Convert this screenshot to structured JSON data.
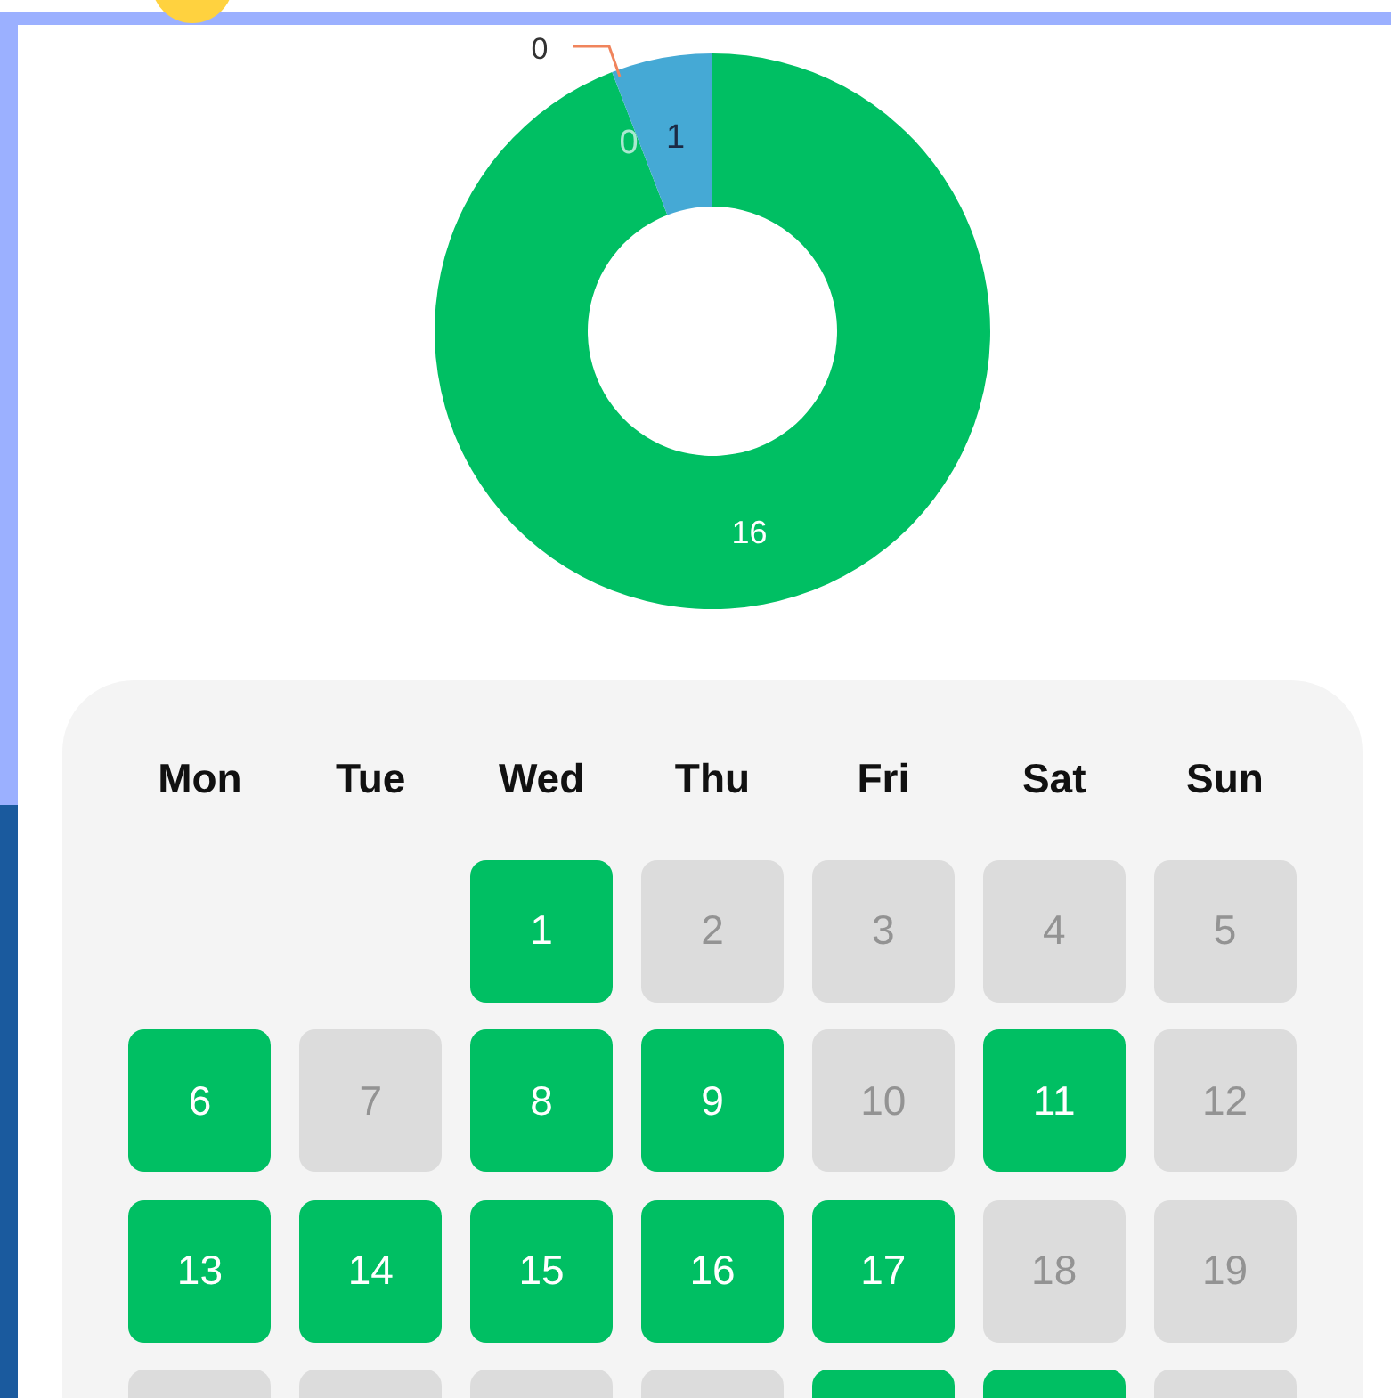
{
  "chart_data": {
    "type": "donut",
    "data_labels": true,
    "value_labels": [
      "16",
      "1",
      "0",
      "0"
    ],
    "series": [
      {
        "values": [
          16,
          1,
          0,
          0
        ],
        "colors": [
          "#00bf63",
          "#45a9d5",
          "#a9e8d0",
          "#f0845c"
        ]
      }
    ]
  },
  "calendar": {
    "weekdays": [
      "Mon",
      "Tue",
      "Wed",
      "Thu",
      "Fri",
      "Sat",
      "Sun"
    ],
    "weeks": [
      [
        {
          "kind": "blank"
        },
        {
          "kind": "blank"
        },
        {
          "kind": "day",
          "day": "1",
          "done": true
        },
        {
          "kind": "day",
          "day": "2",
          "done": false
        },
        {
          "kind": "day",
          "day": "3",
          "done": false
        },
        {
          "kind": "day",
          "day": "4",
          "done": false
        },
        {
          "kind": "day",
          "day": "5",
          "done": false
        }
      ],
      [
        {
          "kind": "day",
          "day": "6",
          "done": true
        },
        {
          "kind": "day",
          "day": "7",
          "done": false
        },
        {
          "kind": "day",
          "day": "8",
          "done": true
        },
        {
          "kind": "day",
          "day": "9",
          "done": true
        },
        {
          "kind": "day",
          "day": "10",
          "done": false
        },
        {
          "kind": "day",
          "day": "11",
          "done": true
        },
        {
          "kind": "day",
          "day": "12",
          "done": false
        }
      ],
      [
        {
          "kind": "day",
          "day": "13",
          "done": true
        },
        {
          "kind": "day",
          "day": "14",
          "done": true
        },
        {
          "kind": "day",
          "day": "15",
          "done": true
        },
        {
          "kind": "day",
          "day": "16",
          "done": true
        },
        {
          "kind": "day",
          "day": "17",
          "done": true
        },
        {
          "kind": "day",
          "day": "18",
          "done": false
        },
        {
          "kind": "day",
          "day": "19",
          "done": false
        }
      ],
      [
        {
          "kind": "day",
          "done": false
        },
        {
          "kind": "day",
          "done": false
        },
        {
          "kind": "day",
          "done": false
        },
        {
          "kind": "day",
          "done": false
        },
        {
          "kind": "day",
          "done": true
        },
        {
          "kind": "day",
          "done": true
        },
        {
          "kind": "day",
          "done": false
        }
      ]
    ]
  }
}
